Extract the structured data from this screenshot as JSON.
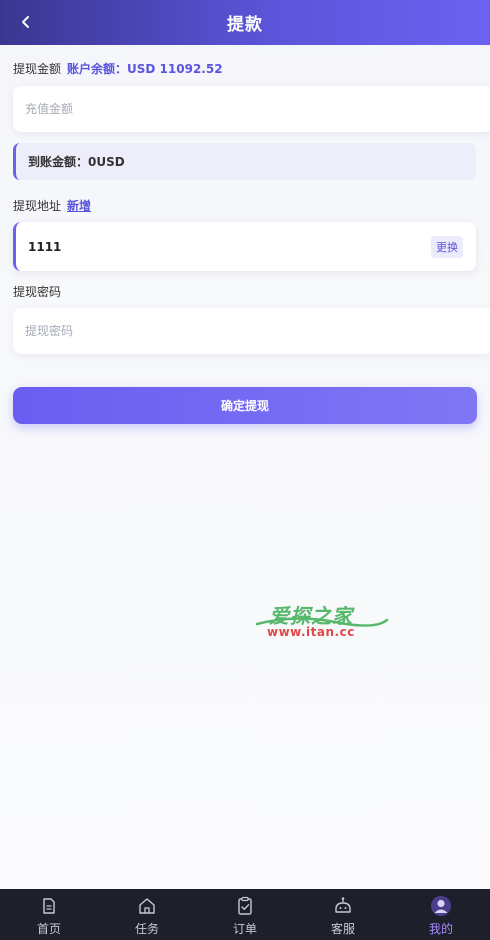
{
  "header": {
    "title": "提款",
    "back_icon": "chevron-left-icon"
  },
  "amount_section": {
    "label": "提现金额",
    "balance_text": "账户余额：USD 11092.52",
    "input_placeholder": "充值金额",
    "input_value": ""
  },
  "receive": {
    "text": "到账金额：0USD"
  },
  "address_section": {
    "label": "提现地址",
    "add_link": "新增",
    "address_value": "1111",
    "change_label": "更换"
  },
  "password_section": {
    "label": "提现密码",
    "input_placeholder": "提现密码",
    "input_value": ""
  },
  "submit": {
    "label": "确定提现"
  },
  "watermark": {
    "top_text": "爱探之家",
    "bottom_text": "www.itan.cc"
  },
  "tabbar": {
    "items": [
      {
        "label": "首页",
        "icon": "document-icon",
        "active": false
      },
      {
        "label": "任务",
        "icon": "home-icon",
        "active": false
      },
      {
        "label": "订单",
        "icon": "clipboard-icon",
        "active": false
      },
      {
        "label": "客服",
        "icon": "robot-icon",
        "active": false
      },
      {
        "label": "我的",
        "icon": "user-avatar-icon",
        "active": true
      }
    ]
  },
  "colors": {
    "accent": "#5b54e0",
    "header_start": "#3a3690",
    "header_end": "#6b62f2",
    "tabbar_bg": "#1d1f2b",
    "active_tab": "#a78bfa"
  }
}
